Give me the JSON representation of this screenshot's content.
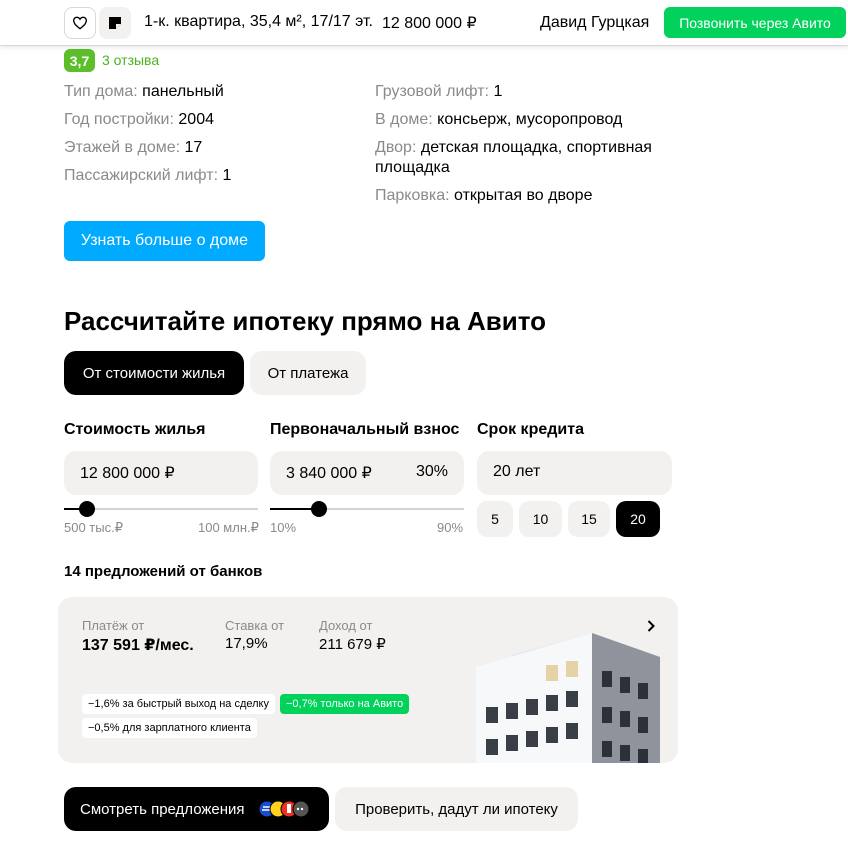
{
  "header": {
    "title": "1-к. квартира, 35,4 м², 17/17 эт.",
    "price": "12 800 000 ₽",
    "seller": "Давид Гурцкая",
    "call_label": "Позвонить через Авито"
  },
  "rating": {
    "score": "3,7",
    "reviews": "3 отзыва"
  },
  "house": {
    "left": [
      {
        "k": "Тип дома:",
        "v": "панельный"
      },
      {
        "k": "Год постройки:",
        "v": "2004"
      },
      {
        "k": "Этажей в доме:",
        "v": "17"
      },
      {
        "k": "Пассажирский лифт:",
        "v": "1"
      }
    ],
    "right": [
      {
        "k": "Грузовой лифт:",
        "v": "1"
      },
      {
        "k": "В доме:",
        "v": "консьерж, мусоропровод"
      },
      {
        "k": "Двор:",
        "v": "детская площадка, спортивная площадка"
      },
      {
        "k": "Парковка:",
        "v": "открытая во дворе"
      }
    ],
    "more_button": "Узнать больше о доме"
  },
  "mortgage": {
    "title": "Рассчитайте ипотеку прямо на Авито",
    "tab_active": "От стоимости жилья",
    "tab_inactive": "От платежа",
    "price_label": "Стоимость жилья",
    "price_value": "12 800 000 ₽",
    "price_min": "500 тыс.₽",
    "price_max": "100 млн.₽",
    "price_slider_fraction": 0.12,
    "down_label": "Первоначальный взнос",
    "down_value": "3 840 000 ₽",
    "down_percent": "30%",
    "down_min": "10%",
    "down_max": "90%",
    "down_slider_fraction": 0.25,
    "term_label": "Срок кредита",
    "term_value": "20 лет",
    "term_options": [
      "5",
      "10",
      "15",
      "20"
    ],
    "term_selected": "20",
    "offers_title": "14 предложений от банков",
    "card": {
      "payment_label": "Платёж от",
      "payment_value": "137 591 ₽/мес.",
      "rate_label": "Ставка от",
      "rate_value": "17,9%",
      "income_label": "Доход от",
      "income_value": "211 679 ₽",
      "badge_fast": "−1,6% за быстрый выход на сделку",
      "badge_avito": "−0,7% только на Авито",
      "badge_salary": "−0,5% для зарплатного клиента"
    },
    "offers_button": "Смотреть предложения",
    "check_button": "Проверить, дадут ли ипотеку"
  },
  "colors": {
    "avito_green": "#02d15c",
    "avito_blue": "#00aaff",
    "rating_green": "#5cbf2a",
    "surface": "#f2f1f0"
  },
  "icons": {
    "favorite": "heart-icon",
    "note": "note-icon",
    "card_arrow": "chevron-right-icon",
    "banks": "bank-logos-icon"
  }
}
